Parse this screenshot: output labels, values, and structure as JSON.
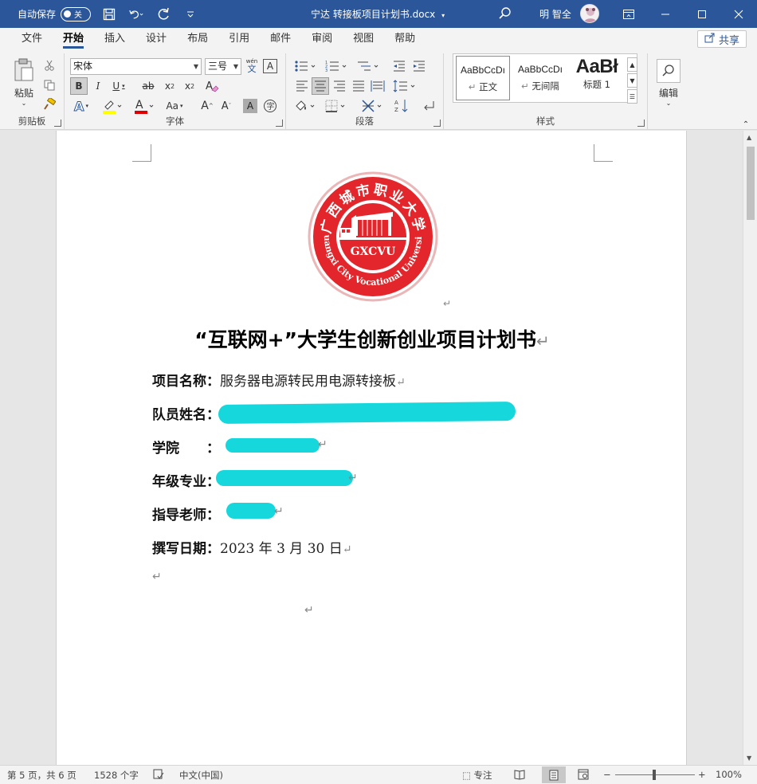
{
  "titlebar": {
    "autosave_label": "自动保存",
    "autosave_state": "关",
    "document_title": "宁达 转接板项目计划书.docx",
    "user_name": "明 智全"
  },
  "tabs": [
    "文件",
    "开始",
    "插入",
    "设计",
    "布局",
    "引用",
    "邮件",
    "审阅",
    "视图",
    "帮助"
  ],
  "share_label": "共享",
  "ribbon": {
    "clipboard": {
      "paste_label": "粘贴",
      "group_label": "剪贴板"
    },
    "font": {
      "font_name": "宋体",
      "font_size": "三号",
      "phonetic_label": "wén",
      "phonetic_char": "文",
      "group_label": "字体"
    },
    "paragraph": {
      "group_label": "段落"
    },
    "styles": {
      "items": [
        {
          "preview": "AaBbCcDı",
          "name": "正文"
        },
        {
          "preview": "AaBbCcDı",
          "name": "无间隔"
        },
        {
          "preview": "AaBł",
          "name": "标题 1"
        }
      ],
      "group_label": "样式"
    },
    "editing": {
      "label": "编辑"
    }
  },
  "document": {
    "title": "“互联网+”大学生创新创业项目计划书",
    "logo": {
      "abbr": "GXCVU",
      "top_text": "广西城市职业大学",
      "bottom_text": "Guangxi City Vocational University"
    },
    "fields": [
      {
        "label": "项目名称：",
        "value": "服务器电源转民用电源转接板"
      },
      {
        "label": "队员姓名：",
        "value": ""
      },
      {
        "label": "学院　　：",
        "value": ""
      },
      {
        "label": "年级专业：",
        "value": ""
      },
      {
        "label": "指导老师：",
        "value": ""
      },
      {
        "label": "撰写日期：",
        "value": "2023 年 3 月 30 日"
      }
    ],
    "paragraph_mark": "↵"
  },
  "statusbar": {
    "page_info": "第 5 页，共 6 页",
    "word_count": "1528 个字",
    "language": "中文(中国)",
    "focus_label": "专注",
    "zoom": "100%",
    "zoom_value": 100
  },
  "colors": {
    "titlebar": "#2b579a",
    "logo_red": "#e3262b",
    "redaction": "#16d7db"
  }
}
